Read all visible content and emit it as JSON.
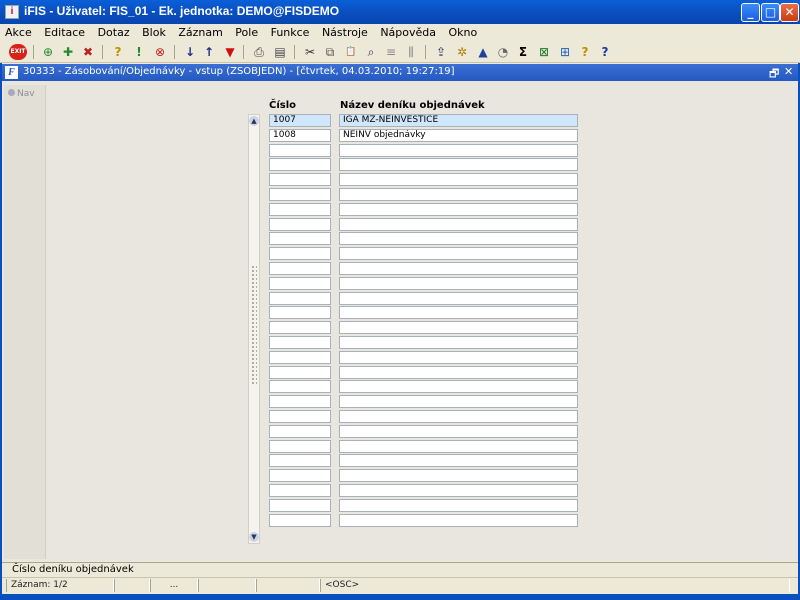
{
  "window": {
    "title": "iFIS - Uživatel: FIS_01 - Ek. jednotka: DEMO@FISDEMO",
    "app_icon": "iFIS-logo",
    "minimize_symbol": "_",
    "maximize_symbol": "□",
    "close_symbol": "✕"
  },
  "menu": {
    "items": [
      "Akce",
      "Editace",
      "Dotaz",
      "Blok",
      "Záznam",
      "Pole",
      "Funkce",
      "Nástroje",
      "Nápověda",
      "Okno"
    ]
  },
  "toolbar": {
    "exit_label": "EXIT",
    "icons": [
      {
        "name": "exit-icon",
        "glyph": "EXIT"
      },
      {
        "name": "insert-record-icon",
        "glyph": "⊕"
      },
      {
        "name": "save-record-icon",
        "glyph": "✚"
      },
      {
        "name": "delete-record-icon",
        "glyph": "✖"
      },
      {
        "name": "query-enter-icon",
        "glyph": "?"
      },
      {
        "name": "query-execute-icon",
        "glyph": "!"
      },
      {
        "name": "query-cancel-icon",
        "glyph": "⊗"
      },
      {
        "name": "sort-asc-icon",
        "glyph": "↓"
      },
      {
        "name": "sort-desc-icon",
        "glyph": "↑"
      },
      {
        "name": "filter-icon",
        "glyph": "▼"
      },
      {
        "name": "print-icon",
        "glyph": "⎙"
      },
      {
        "name": "print-preview-icon",
        "glyph": "▤"
      },
      {
        "name": "cut-icon",
        "glyph": "✂"
      },
      {
        "name": "copy-icon",
        "glyph": "⧉"
      },
      {
        "name": "paste-icon",
        "glyph": "📋"
      },
      {
        "name": "find-icon",
        "glyph": "⌕"
      },
      {
        "name": "indent-icon",
        "glyph": "≡"
      },
      {
        "name": "columns-icon",
        "glyph": "⫼"
      },
      {
        "name": "export-icon",
        "glyph": "⇪"
      },
      {
        "name": "settings-icon",
        "glyph": "✲"
      },
      {
        "name": "chart-icon",
        "glyph": "▲"
      },
      {
        "name": "clock-icon",
        "glyph": "◔"
      },
      {
        "name": "sum-icon",
        "glyph": "Σ"
      },
      {
        "name": "excel-icon",
        "glyph": "⊠"
      },
      {
        "name": "network-icon",
        "glyph": "⊞"
      },
      {
        "name": "help-topics-icon",
        "glyph": "?"
      },
      {
        "name": "context-help-icon",
        "glyph": "?"
      }
    ]
  },
  "form": {
    "title": "30333 - Zásobování/Objednávky - vstup (ZSOBJEDN) - [čtvrtek, 04.03.2010; 19:27:19]",
    "restore_symbol": "🗗",
    "close_symbol": "✕",
    "nav_label": "Nav",
    "grid": {
      "headers": [
        "Číslo",
        "Název deníku objednávek"
      ],
      "rows": [
        [
          "1007",
          "IGA MZ-NEINVESTICE"
        ],
        [
          "1008",
          "NEINV objednávky"
        ]
      ],
      "visible_row_count": 28
    }
  },
  "status": {
    "hint": "Číslo deníku objednávek",
    "record": "Záznam: 1/2",
    "ellipsis": "...",
    "mode": "<OSC>"
  },
  "colors": {
    "title_bar": "#0a4fc0",
    "selected_row": "#cfe6fb",
    "window_bg": "#ece9d8"
  }
}
